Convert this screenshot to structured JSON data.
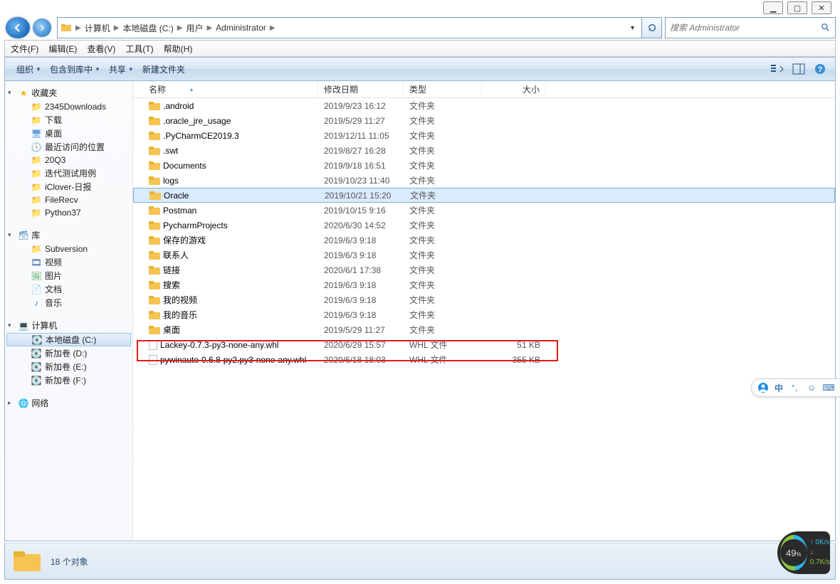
{
  "window_controls": {
    "min": "▁",
    "max": "▢",
    "close": "✕"
  },
  "breadcrumb": [
    "计算机",
    "本地磁盘 (C:)",
    "用户",
    "Administrator"
  ],
  "search": {
    "placeholder": "搜索 Administrator"
  },
  "menubar": [
    "文件(F)",
    "编辑(E)",
    "查看(V)",
    "工具(T)",
    "帮助(H)"
  ],
  "toolbar": {
    "organize": "组织",
    "include": "包含到库中",
    "share": "共享",
    "newfolder": "新建文件夹"
  },
  "sidebar": {
    "favorites": {
      "label": "收藏夹",
      "items": [
        "2345Downloads",
        "下载",
        "桌面",
        "最近访问的位置",
        "20Q3",
        "迭代测试用例",
        "iClover-日报",
        "FileRecv",
        "Python37"
      ]
    },
    "libraries": {
      "label": "库",
      "items": [
        "Subversion",
        "视频",
        "图片",
        "文档",
        "音乐"
      ]
    },
    "computer": {
      "label": "计算机",
      "items": [
        "本地磁盘 (C:)",
        "新加卷 (D:)",
        "新加卷 (E:)",
        "新加卷 (F:)"
      ]
    },
    "network": {
      "label": "网络"
    }
  },
  "columns": {
    "name": "名称",
    "date": "修改日期",
    "type": "类型",
    "size": "大小"
  },
  "files": [
    {
      "name": ".android",
      "date": "2019/9/23 16:12",
      "type": "文件夹",
      "size": "",
      "icon": "folder"
    },
    {
      "name": ".oracle_jre_usage",
      "date": "2019/5/29 11:27",
      "type": "文件夹",
      "size": "",
      "icon": "folder"
    },
    {
      "name": ".PyCharmCE2019.3",
      "date": "2019/12/11 11:05",
      "type": "文件夹",
      "size": "",
      "icon": "folder"
    },
    {
      "name": ".swt",
      "date": "2019/8/27 16:28",
      "type": "文件夹",
      "size": "",
      "icon": "folder"
    },
    {
      "name": "Documents",
      "date": "2019/9/18 16:51",
      "type": "文件夹",
      "size": "",
      "icon": "folder"
    },
    {
      "name": "logs",
      "date": "2019/10/23 11:40",
      "type": "文件夹",
      "size": "",
      "icon": "folder"
    },
    {
      "name": "Oracle",
      "date": "2019/10/21 15:20",
      "type": "文件夹",
      "size": "",
      "icon": "folder",
      "selected": true
    },
    {
      "name": "Postman",
      "date": "2019/10/15 9:16",
      "type": "文件夹",
      "size": "",
      "icon": "folder"
    },
    {
      "name": "PycharmProjects",
      "date": "2020/6/30 14:52",
      "type": "文件夹",
      "size": "",
      "icon": "folder"
    },
    {
      "name": "保存的游戏",
      "date": "2019/6/3 9:18",
      "type": "文件夹",
      "size": "",
      "icon": "folder"
    },
    {
      "name": "联系人",
      "date": "2019/6/3 9:18",
      "type": "文件夹",
      "size": "",
      "icon": "folder"
    },
    {
      "name": "链接",
      "date": "2020/6/1 17:38",
      "type": "文件夹",
      "size": "",
      "icon": "folder"
    },
    {
      "name": "搜索",
      "date": "2019/6/3 9:18",
      "type": "文件夹",
      "size": "",
      "icon": "folder"
    },
    {
      "name": "我的视频",
      "date": "2019/6/3 9:18",
      "type": "文件夹",
      "size": "",
      "icon": "folder"
    },
    {
      "name": "我的音乐",
      "date": "2019/6/3 9:18",
      "type": "文件夹",
      "size": "",
      "icon": "folder"
    },
    {
      "name": "桌面",
      "date": "2019/5/29 11:27",
      "type": "文件夹",
      "size": "",
      "icon": "folder"
    },
    {
      "name": "Lackey-0.7.3-py3-none-any.whl",
      "date": "2020/6/29 15:57",
      "type": "WHL 文件",
      "size": "51 KB",
      "icon": "file",
      "highlight": true
    },
    {
      "name": "pywinauto-0.6.8-py2.py3-none-any.whl",
      "date": "2020/6/18 18:03",
      "type": "WHL 文件",
      "size": "355 KB",
      "icon": "file"
    }
  ],
  "status": {
    "count_label": "18 个对象"
  },
  "speed": {
    "pct": "49",
    "pct_unit": "%",
    "up": "0K/s",
    "down": "0.7K/s"
  },
  "sidewidget": {
    "label": "中"
  }
}
